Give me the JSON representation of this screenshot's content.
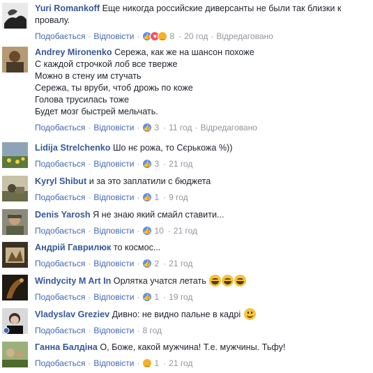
{
  "actions": {
    "like_label": "Подобається",
    "reply_label": "Відповісти",
    "separator": "·"
  },
  "colors": {
    "author": "#365899",
    "link": "#4267b2",
    "meta": "#90949c",
    "like_reaction": "#5890ff",
    "love_reaction": "#f25268",
    "haha_reaction": "#f7b125"
  },
  "comments": [
    {
      "author": "Yuri Romankoff",
      "lines": [
        "Еще никогда российские диверсанты не были так близки к провалу."
      ],
      "reactions": [
        "like-icon",
        "love-icon",
        "haha-icon"
      ],
      "reaction_count": "8",
      "time": "20 год",
      "edited": "Відредаговано"
    },
    {
      "author": "Andrey Mironenko",
      "lines": [
        "Сережа, как же на шансон похоже",
        "С каждой строчкой лоб все тверже",
        "Можно в стену им стучать",
        "Сережа, ты вруби, чтоб дрожь по коже",
        "Голова трусилась тоже",
        "Будет мозг быстрей мельчать."
      ],
      "reactions": [
        "like-icon"
      ],
      "reaction_count": "3",
      "time": "11 год",
      "edited": "Відредаговано"
    },
    {
      "author": "Lidija Strelchenko",
      "lines": [
        "Шо нє рожа, то Сєрькожа %))"
      ],
      "reactions": [
        "like-icon"
      ],
      "reaction_count": "3",
      "time": "21 год",
      "edited": ""
    },
    {
      "author": "Kyryl Shibut",
      "lines": [
        "и за это заплатили с бюджета"
      ],
      "reactions": [
        "like-icon"
      ],
      "reaction_count": "1",
      "time": "9 год",
      "edited": ""
    },
    {
      "author": "Denis Yarosh",
      "lines": [
        "Я не знаю який смайл ставити..."
      ],
      "reactions": [
        "like-icon"
      ],
      "reaction_count": "10",
      "time": "21 год",
      "edited": ""
    },
    {
      "author": "Андрій Гаврилюк",
      "lines": [
        "то космос..."
      ],
      "reactions": [
        "like-icon"
      ],
      "reaction_count": "2",
      "time": "21 год",
      "edited": ""
    },
    {
      "author": "Windycity M Art In",
      "lines": [
        "Орлятка учатся летать"
      ],
      "emoji": [
        "laughing-emoji",
        "laughing-emoji",
        "laughing-emoji"
      ],
      "reactions": [
        "like-icon"
      ],
      "reaction_count": "1",
      "time": "19 год",
      "edited": ""
    },
    {
      "author": "Vladyslav Greziev",
      "lines": [
        "Дивно: не видно пальне в кадрі"
      ],
      "emoji": [
        "smiling-emoji"
      ],
      "reactions": [],
      "reaction_count": "",
      "time": "8 год",
      "edited": ""
    },
    {
      "author": "Ганна Балдіна",
      "lines": [
        "О, Боже, какой мужчина! Т.е. мужчины. Тьфу!"
      ],
      "reactions": [
        "haha-icon"
      ],
      "reaction_count": "1",
      "time": "21 год",
      "edited": ""
    }
  ]
}
